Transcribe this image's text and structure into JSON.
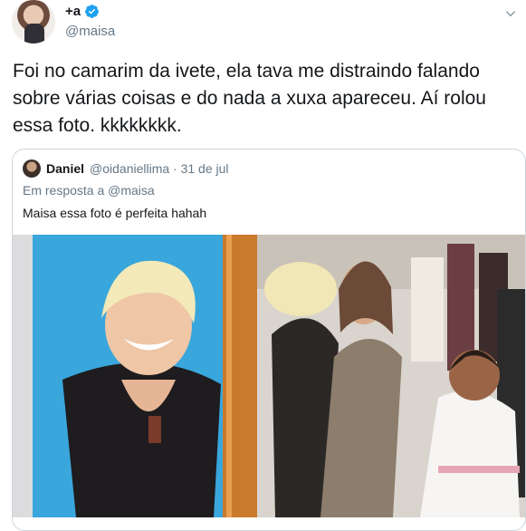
{
  "author": {
    "display_name": "+a",
    "handle": "@maisa",
    "verified": true
  },
  "tweet": {
    "text": "Foi no camarim da ivete, ela tava me distraindo falando sobre várias coisas e do nada a xuxa apareceu. Aí rolou essa foto. kkkkkkkk."
  },
  "quoted_tweet": {
    "display_name": "Daniel",
    "handle_date": "@oidaniellima · 31 de jul",
    "reply_to": "Em resposta a @maisa",
    "text": "Maisa essa foto é perfeita hahah"
  },
  "icons": [
    "verified-badge-icon",
    "chevron-down-icon"
  ],
  "colors": {
    "verified": "#1da1f2",
    "secondary_text": "#657786",
    "border": "#ccd6dd"
  }
}
